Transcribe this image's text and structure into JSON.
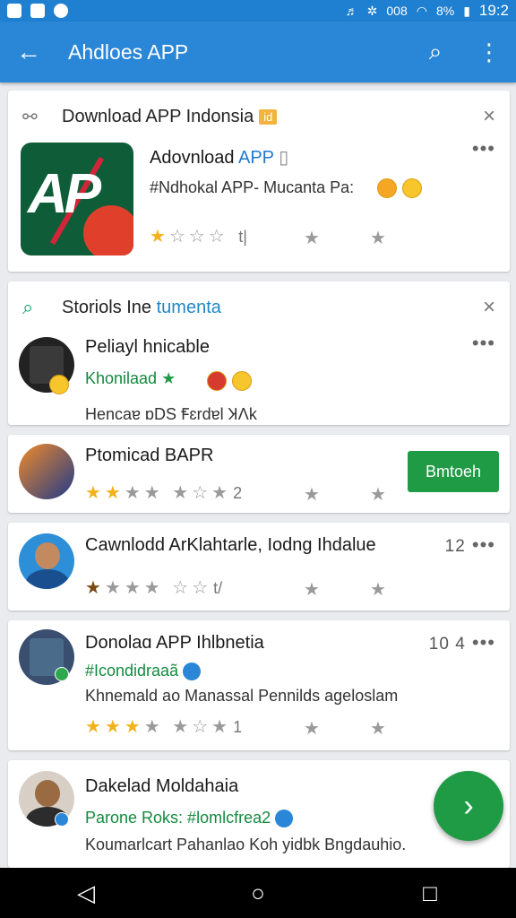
{
  "status_bar": {
    "icons": [
      "image-icon",
      "messenger-icon",
      "circle-icon"
    ],
    "battery": "8%",
    "time": "19:2",
    "network": "008"
  },
  "app_bar": {
    "back_icon": "arrow-left-icon",
    "title": "Ahdloes APP",
    "search_icon": "search-icon",
    "menu_icon": "more-vert-icon"
  },
  "card1": {
    "header_title": "Download APP Indonsia",
    "header_badge": "id",
    "close": "×",
    "app_title_prefix": "Adovnload ",
    "app_title_accent": "APP",
    "app_subtitle": "#Ndhokal APP- Mucanta Pa:",
    "rating_num": "t|",
    "rating_stars": 1,
    "more": "•••"
  },
  "card2": {
    "header_title": "Storiols Ine ",
    "header_accent": "tumenta",
    "close": "×",
    "item_title": "Peliayl hnicable",
    "item_subtitle": "Khonilaad",
    "item_desc": "Hencaɐ ɒDS Ꞙɛrdɐl ꞰɅk",
    "more": "•••"
  },
  "card3": {
    "title": "Ptomicad BAPR",
    "install_label": "Bmtoeh",
    "rating_stars": 2,
    "rating_num": "2"
  },
  "card4": {
    "title": "Cawnlodd ArKlahtarle, Iodng Ihdalue",
    "time": "12",
    "more": "•••",
    "rating_stars": 1,
    "rating_num": "t/"
  },
  "card5": {
    "title": "Donolaɑ APP Ihlbnetia",
    "time": "10 4",
    "more": "•••",
    "subtitle": "#Icondidraaã",
    "desc": "Khnemald ao  Manassal  Pennilds ageloslam",
    "rating_stars": 3,
    "rating_num": "1"
  },
  "card6": {
    "title": "Dakelad Moldahaia",
    "subtitle": "Parone Roks: #lomlcfrea2",
    "desc": "Koumarlcart Pahanlao Koh yidbk Bngdauhio."
  },
  "fab_icon": "chevron-right-icon",
  "fab_label": "›",
  "nav": {
    "back": "◁",
    "home": "○",
    "recents": "□"
  }
}
